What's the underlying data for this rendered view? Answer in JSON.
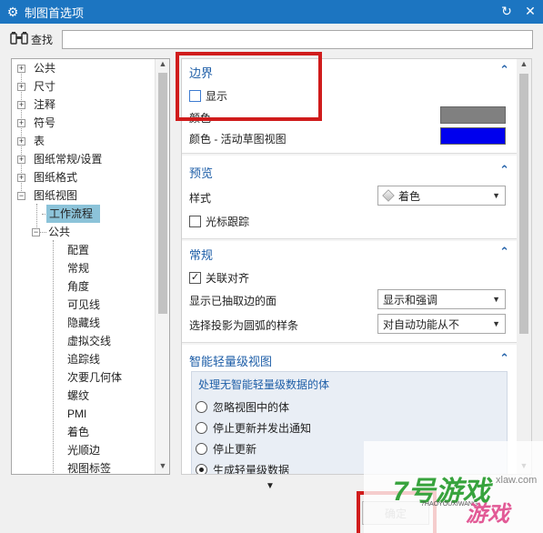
{
  "window": {
    "title": "制图首选项"
  },
  "search": {
    "label": "查找",
    "value": ""
  },
  "tree": {
    "items": [
      {
        "label": "公共",
        "expander": "+"
      },
      {
        "label": "尺寸",
        "expander": "+"
      },
      {
        "label": "注释",
        "expander": "+"
      },
      {
        "label": "符号",
        "expander": "+"
      },
      {
        "label": "表",
        "expander": "+"
      },
      {
        "label": "图纸常规/设置",
        "expander": "+"
      },
      {
        "label": "图纸格式",
        "expander": "+"
      },
      {
        "label": "图纸视图",
        "expander": "−"
      },
      {
        "label": "工作流程",
        "expander": ""
      },
      {
        "label": "公共",
        "expander": "−"
      },
      {
        "label": "配置",
        "expander": ""
      },
      {
        "label": "常规",
        "expander": ""
      },
      {
        "label": "角度",
        "expander": ""
      },
      {
        "label": "可见线",
        "expander": ""
      },
      {
        "label": "隐藏线",
        "expander": ""
      },
      {
        "label": "虚拟交线",
        "expander": ""
      },
      {
        "label": "追踪线",
        "expander": ""
      },
      {
        "label": "次要几何体",
        "expander": ""
      },
      {
        "label": "螺纹",
        "expander": ""
      },
      {
        "label": "PMI",
        "expander": ""
      },
      {
        "label": "着色",
        "expander": ""
      },
      {
        "label": "光顺边",
        "expander": ""
      },
      {
        "label": "视图标签",
        "expander": ""
      }
    ],
    "selected": "工作流程"
  },
  "border_section": {
    "header": "边界",
    "show_label": "显示",
    "show_checked": false,
    "color_label": "颜色",
    "color_value": "#808080",
    "active_color_label": "颜色 - 活动草图视图",
    "active_color_value": "#0000ee"
  },
  "preview_section": {
    "header": "预览",
    "style_label": "样式",
    "style_value": "着色",
    "cursor_label": "光标跟踪",
    "cursor_checked": false
  },
  "general_section": {
    "header": "常规",
    "assoc_label": "关联对齐",
    "assoc_checked": true,
    "silhouette_label": "显示已抽取边的面",
    "silhouette_value": "显示和强调",
    "arc_label": "选择投影为圆弧的样条",
    "arc_value": "对自动功能从不"
  },
  "lightweight_section": {
    "header": "智能轻量级视图",
    "subheader": "处理无智能轻量级数据的体",
    "options": [
      {
        "label": "忽略视图中的体",
        "selected": false
      },
      {
        "label": "停止更新并发出通知",
        "selected": false
      },
      {
        "label": "停止更新",
        "selected": false
      },
      {
        "label": "生成轻量级数据",
        "selected": true
      }
    ]
  },
  "footer": {
    "ok_label": "确定"
  },
  "watermark": {
    "line1": "7号游戏",
    "line2": "游戏",
    "line3": "xlaw.com",
    "line4": "7HAOYOUXIWANG"
  },
  "icons": {
    "gear": "gear-icon",
    "binoculars": "binoculars-icon",
    "reset": "reset-icon",
    "close": "close-icon",
    "collapse": "chevron-up-icon",
    "dropdown": "chevron-down-icon"
  }
}
